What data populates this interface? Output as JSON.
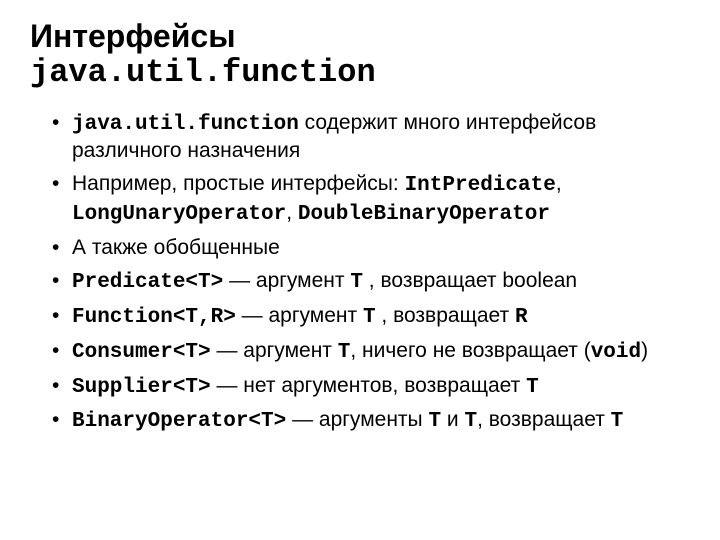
{
  "title": {
    "line1": "Интерфейсы",
    "line2": "java.util.function"
  },
  "bullets": {
    "b0": {
      "code1": "java.util.function",
      "text1": " содержит много интерфейсов различного назначения"
    },
    "b1": {
      "text1": "Например, простые интерфейсы: ",
      "code1": "IntPredicate",
      "text2": ", ",
      "code2": "LongUnaryOperator",
      "text3": ", ",
      "code3": "DoubleBinaryOperator"
    },
    "b2": {
      "text1": "А также обобщенные"
    },
    "b3": {
      "code1": "Predicate<T>",
      "text1": " — аргумент ",
      "code2": "T",
      "text2": " , возвращает boolean"
    },
    "b4": {
      "code1": "Function<T,R>",
      "text1": " — аргумент ",
      "code2": "T",
      "text2": " , возвращает ",
      "code3": "R"
    },
    "b5": {
      "code1": "Consumer<T>",
      "text1": " — аргумент ",
      "code2": "T",
      "text2": ", ничего не возвращает (",
      "code3": "void",
      "text3": ")"
    },
    "b6": {
      "code1": "Supplier<T>",
      "text1": " — нет аргументов, возвращает ",
      "code2": "T"
    },
    "b7": {
      "code1": "BinaryOperator<T>",
      "text1": " — аргументы ",
      "code2": "T",
      "text2": " и ",
      "code3": "T",
      "text3": ", возвращает ",
      "code4": "T"
    }
  }
}
